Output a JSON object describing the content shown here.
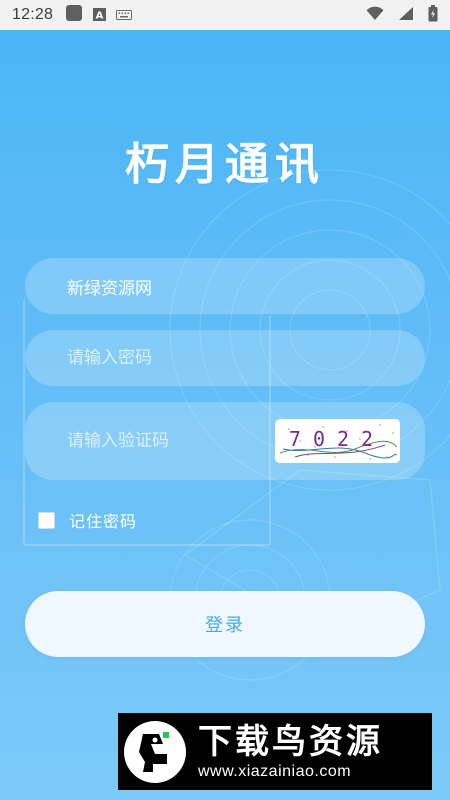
{
  "status_bar": {
    "time": "12:28",
    "left_icons": [
      "square-icon",
      "a-icon",
      "keyboard-icon"
    ],
    "right_icons": [
      "wifi-icon",
      "signal-icon",
      "battery-icon"
    ]
  },
  "app": {
    "title": "朽月通讯"
  },
  "form": {
    "username_value": "新绿资源网",
    "password_placeholder": "请输入密码",
    "captcha_placeholder": "请输入验证码",
    "captcha_code": "7022",
    "remember_label": "记住密码",
    "remember_checked": false,
    "login_label": "登录"
  },
  "watermark": {
    "title": "下载鸟资源",
    "url": "www.xiazainiao.com"
  },
  "colors": {
    "background_top": "#48b6f6",
    "background_bottom": "#7dcaf9",
    "login_text": "#4aa7e8",
    "captcha_text": "#7a2a8a"
  }
}
